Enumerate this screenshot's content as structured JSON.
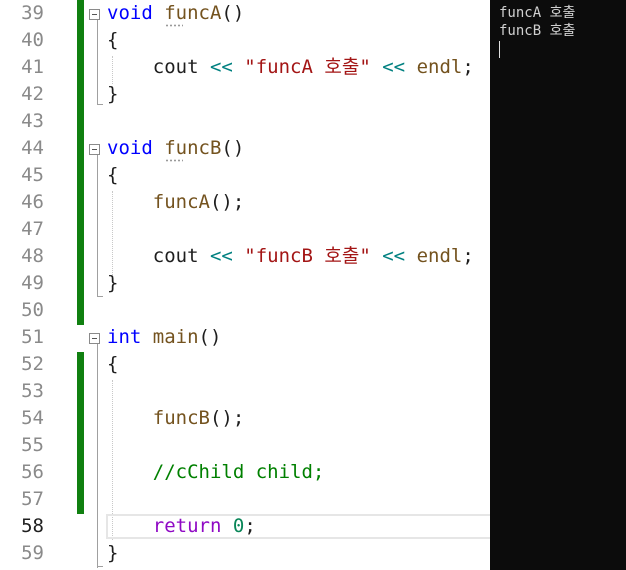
{
  "editor": {
    "lines": [
      {
        "n": "39",
        "tokens": [
          {
            "t": "void",
            "c": "kw"
          },
          {
            "t": " "
          },
          {
            "t": "funcA",
            "c": "fn"
          },
          {
            "t": "()"
          }
        ]
      },
      {
        "n": "40",
        "tokens": [
          {
            "t": "{"
          }
        ]
      },
      {
        "n": "41",
        "tokens": [
          {
            "t": "    cout "
          },
          {
            "t": "<<",
            "c": "op"
          },
          {
            "t": " "
          },
          {
            "t": "\"funcA 호출\"",
            "c": "str"
          },
          {
            "t": " "
          },
          {
            "t": "<<",
            "c": "op"
          },
          {
            "t": " "
          },
          {
            "t": "endl",
            "c": "fn"
          },
          {
            "t": ";"
          }
        ]
      },
      {
        "n": "42",
        "tokens": [
          {
            "t": "}"
          }
        ]
      },
      {
        "n": "43",
        "tokens": []
      },
      {
        "n": "44",
        "tokens": [
          {
            "t": "void",
            "c": "kw"
          },
          {
            "t": " "
          },
          {
            "t": "funcB",
            "c": "fn"
          },
          {
            "t": "()"
          }
        ]
      },
      {
        "n": "45",
        "tokens": [
          {
            "t": "{"
          }
        ]
      },
      {
        "n": "46",
        "tokens": [
          {
            "t": "    "
          },
          {
            "t": "funcA",
            "c": "fn"
          },
          {
            "t": "();"
          }
        ]
      },
      {
        "n": "47",
        "tokens": []
      },
      {
        "n": "48",
        "tokens": [
          {
            "t": "    cout "
          },
          {
            "t": "<<",
            "c": "op"
          },
          {
            "t": " "
          },
          {
            "t": "\"funcB 호출\"",
            "c": "str"
          },
          {
            "t": " "
          },
          {
            "t": "<<",
            "c": "op"
          },
          {
            "t": " "
          },
          {
            "t": "endl",
            "c": "fn"
          },
          {
            "t": ";"
          }
        ]
      },
      {
        "n": "49",
        "tokens": [
          {
            "t": "}"
          }
        ]
      },
      {
        "n": "50",
        "tokens": []
      },
      {
        "n": "51",
        "tokens": [
          {
            "t": "int",
            "c": "kw"
          },
          {
            "t": " "
          },
          {
            "t": "main",
            "c": "fn"
          },
          {
            "t": "()"
          }
        ]
      },
      {
        "n": "52",
        "tokens": [
          {
            "t": "{"
          }
        ]
      },
      {
        "n": "53",
        "tokens": []
      },
      {
        "n": "54",
        "tokens": [
          {
            "t": "    "
          },
          {
            "t": "funcB",
            "c": "fn"
          },
          {
            "t": "();"
          }
        ]
      },
      {
        "n": "55",
        "tokens": []
      },
      {
        "n": "56",
        "tokens": [
          {
            "t": "    "
          },
          {
            "t": "//cChild child;",
            "c": "cmt"
          }
        ]
      },
      {
        "n": "57",
        "tokens": []
      },
      {
        "n": "58",
        "tokens": [
          {
            "t": "    "
          },
          {
            "t": "return",
            "c": "ctl"
          },
          {
            "t": " "
          },
          {
            "t": "0",
            "c": "num"
          },
          {
            "t": ";"
          }
        ]
      },
      {
        "n": "59",
        "tokens": [
          {
            "t": "}"
          }
        ]
      }
    ]
  },
  "console": {
    "output_lines": [
      "funcA 호출",
      "funcB 호출"
    ]
  },
  "colors": {
    "keyword": "#0000ff",
    "function": "#74531f",
    "string": "#a31515",
    "operator": "#008080",
    "number": "#098658",
    "comment": "#008000",
    "control": "#8f08c4",
    "change_bar": "#108010",
    "console_bg": "#0c0c0c"
  }
}
